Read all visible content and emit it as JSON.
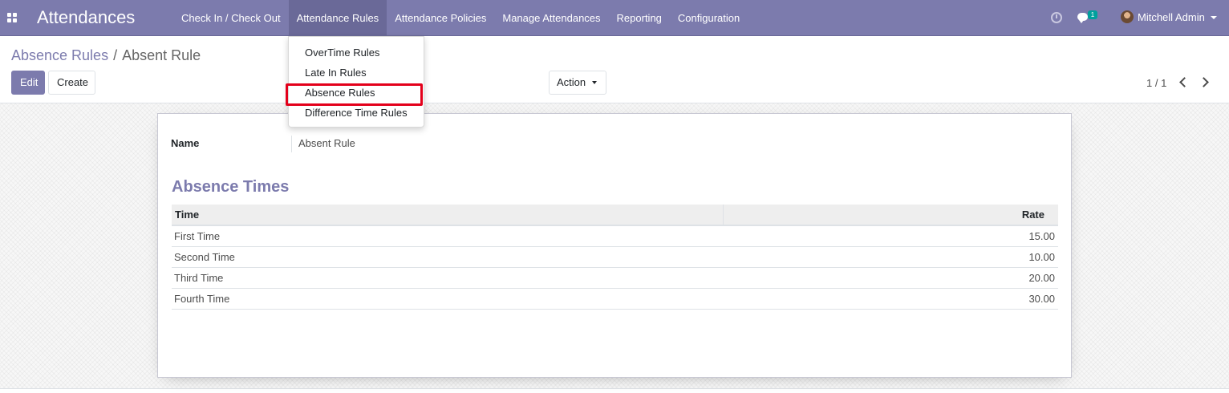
{
  "navbar": {
    "app_title": "Attendances",
    "menu": [
      {
        "label": "Check In / Check Out"
      },
      {
        "label": "Attendance Rules",
        "active": true
      },
      {
        "label": "Attendance Policies"
      },
      {
        "label": "Manage Attendances"
      },
      {
        "label": "Reporting"
      },
      {
        "label": "Configuration"
      }
    ],
    "chat_badge": "1",
    "user_name": "Mitchell Admin",
    "accent_color": "#7c7bad"
  },
  "dropdown": {
    "items": [
      {
        "label": "OverTime Rules"
      },
      {
        "label": "Late In Rules"
      },
      {
        "label": "Absence Rules",
        "highlighted": true
      },
      {
        "label": "Difference Time Rules"
      }
    ],
    "highlight_color": "#e3001b"
  },
  "control_panel": {
    "breadcrumb": {
      "parent": "Absence Rules",
      "separator": "/",
      "current": "Absent Rule"
    },
    "edit_label": "Edit",
    "create_label": "Create",
    "action_label": "Action",
    "pager": "1 / 1"
  },
  "form": {
    "name_label": "Name",
    "name_value": "Absent Rule",
    "section_title": "Absence Times",
    "table": {
      "headers": {
        "time": "Time",
        "rate": "Rate"
      },
      "rows": [
        {
          "time": "First Time",
          "rate": "15.00"
        },
        {
          "time": "Second Time",
          "rate": "10.00"
        },
        {
          "time": "Third Time",
          "rate": "20.00"
        },
        {
          "time": "Fourth Time",
          "rate": "30.00"
        }
      ]
    }
  },
  "icons": {
    "apps": "apps-grid-icon",
    "clock": "clock-icon",
    "chat": "chat-icon",
    "avatar": "avatar",
    "caret": "caret-down-icon",
    "prev": "chevron-left-icon",
    "next": "chevron-right-icon"
  }
}
